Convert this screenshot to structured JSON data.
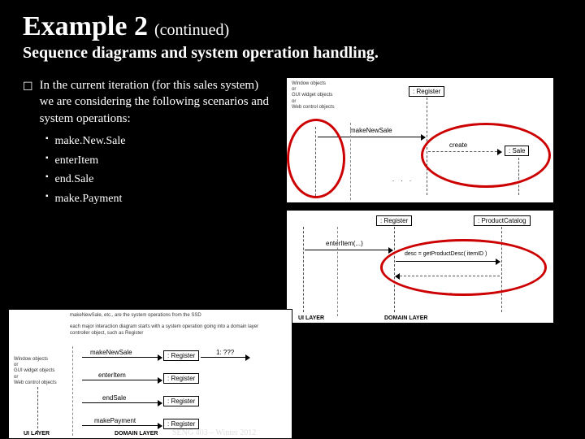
{
  "title": {
    "main": "Example 2",
    "cont": "(continued)"
  },
  "subtitle": "Sequence diagrams and system operation handling.",
  "intro": "In the current iteration (for this sales system)  we are considering the following scenarios and system operations:",
  "bullets": [
    "make.New.Sale",
    "enterItem",
    "end.Sale",
    "make.Payment"
  ],
  "diag": {
    "window_objects": "Window objects\nor\nGUI widget objects\nor\nWeb control objects",
    "register": ": Register",
    "sale": ": Sale",
    "product_catalog": ": ProductCatalog",
    "makeNewSale": "makeNewSale",
    "create": "create",
    "enterItem": "enterItem(...)",
    "desc": "desc = getProductDesc( itemID )",
    "endSale": "endSale",
    "makePayment": "makePayment",
    "ui_layer": "UI LAYER",
    "domain_layer": "DOMAIN LAYER",
    "note": "makeNewSale, etc., are the system operations from the SSD\n\neach major interaction diagram starts with a system operation going into a domain layer controller object, such as Register",
    "q": "1: ???"
  },
  "footer": "SENG 403 – Winter 2012"
}
